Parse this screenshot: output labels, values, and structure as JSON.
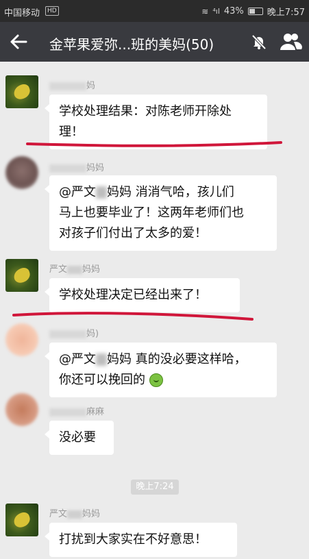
{
  "status_bar": {
    "carrier": "中国移动",
    "hd": "HD",
    "signal": "⁴ıl",
    "battery": "43%",
    "time": "晚上7:57"
  },
  "nav": {
    "title": "金苹果爱弥...班的美妈(50)",
    "icons": [
      "back-arrow-icon",
      "mute-bell-icon",
      "group-members-icon"
    ]
  },
  "messages": [
    {
      "name_suffix": "妈",
      "text": "学校处理结果：对陈老师开除处理！",
      "line1": "学校处理结果：对陈老师开除处",
      "line2": "理！"
    },
    {
      "name_suffix": "妈妈",
      "line1_pre": "@严文",
      "line1_post": "妈妈  消消气哈，孩儿们",
      "line2": "马上也要毕业了！这两年老师们也",
      "line3": "对孩子们付出了太多的爱！"
    },
    {
      "name_prefix": "严文",
      "name_suffix": "妈妈",
      "text": "学校处理决定已经出来了！"
    },
    {
      "name_suffix": "妈)",
      "line1_pre": "@严文",
      "line1_post": "妈妈  真的没必要这样哈，",
      "line2": "你还可以挽回的"
    },
    {
      "name_suffix": "麻麻",
      "text": "没必要"
    },
    {
      "name_prefix": "严文",
      "name_suffix": "妈妈",
      "text": "打扰到大家实在不好意思！"
    }
  ],
  "time_divider": "晚上7:24",
  "colors": {
    "statusbar_bg": "#2b2b2b",
    "navbar_bg": "#393a3f",
    "chat_bg": "#ebebeb",
    "bubble_bg": "#ffffff",
    "annotation_red": "#d0163a"
  }
}
